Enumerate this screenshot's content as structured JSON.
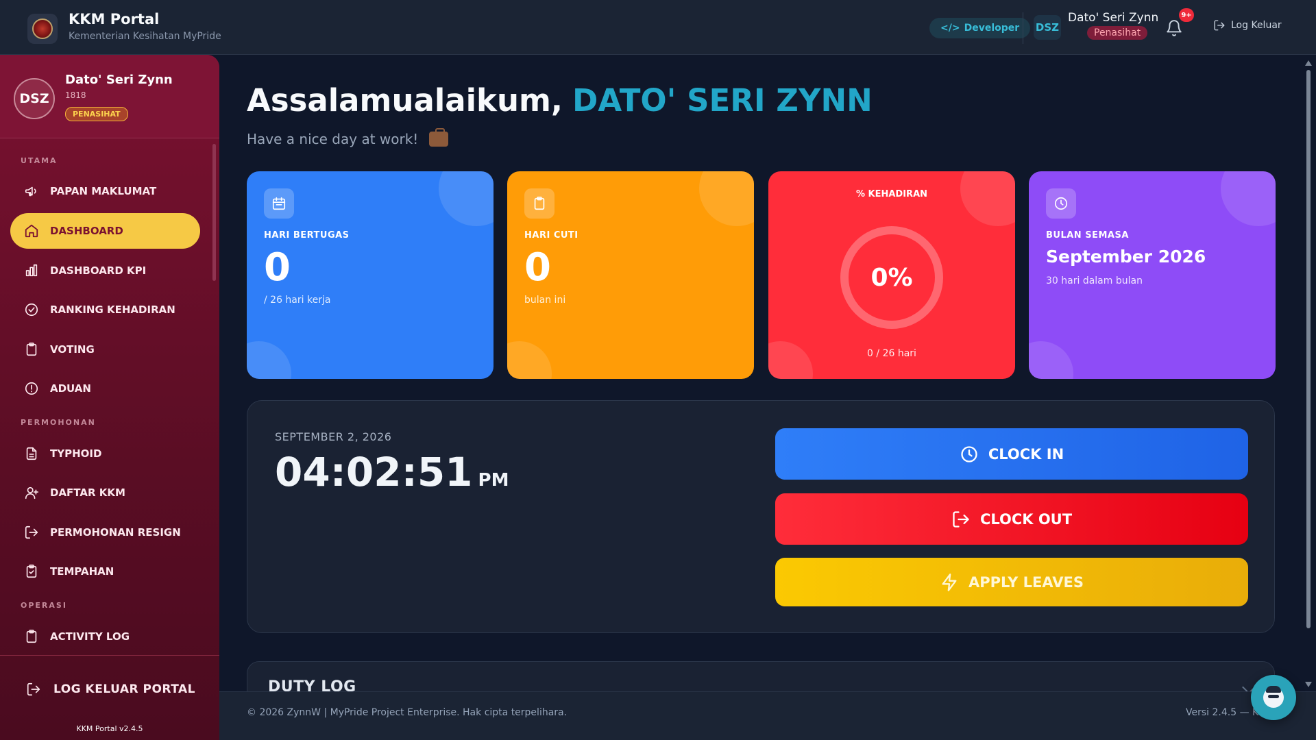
{
  "header": {
    "title": "KKM Portal",
    "subtitle": "Kementerian Kesihatan MyPride",
    "developer_label": "Developer",
    "avatar_initials": "DSZ",
    "user_name": "Dato' Seri Zynn",
    "user_role": "Penasihat",
    "notif_count": "9+",
    "logout_label": "Log Keluar"
  },
  "sidebar": {
    "profile": {
      "initials": "DSZ",
      "name": "Dato' Seri Zynn",
      "id": "1818",
      "role": "PENASIHAT"
    },
    "sections": [
      "UTAMA",
      "PERMOHONAN",
      "OPERASI"
    ],
    "items": [
      {
        "label": "PAPAN MAKLUMAT",
        "icon": "megaphone-icon"
      },
      {
        "label": "DASHBOARD",
        "icon": "home-icon",
        "active": true
      },
      {
        "label": "DASHBOARD KPI",
        "icon": "bar-chart-icon"
      },
      {
        "label": "RANKING KEHADIRAN",
        "icon": "check-circle-icon"
      },
      {
        "label": "VOTING",
        "icon": "clipboard-icon"
      },
      {
        "label": "ADUAN",
        "icon": "alert-circle-icon"
      },
      {
        "label": "TYPHOID",
        "icon": "document-icon"
      },
      {
        "label": "DAFTAR KKM",
        "icon": "user-plus-icon"
      },
      {
        "label": "PERMOHONAN RESIGN",
        "icon": "exit-icon"
      },
      {
        "label": "TEMPAHAN",
        "icon": "clipboard-check-icon"
      },
      {
        "label": "ACTIVITY LOG",
        "icon": "clipboard-icon"
      }
    ],
    "logout_label": "LOG KELUAR PORTAL",
    "version": "KKM Portal v2.4.5"
  },
  "main": {
    "greeting": "Assalamualaikum,",
    "greeting_name": "DATO' SERI ZYNN",
    "subgreeting": "Have a nice day at work!",
    "cards": {
      "duty": {
        "label": "HARI BERTUGAS",
        "value": "0",
        "note": "/ 26 hari kerja"
      },
      "leave": {
        "label": "HARI CUTI",
        "value": "0",
        "note": "bulan ini"
      },
      "attendance": {
        "label": "% KEHADIRAN",
        "value": "0%",
        "note": "0 / 26 hari"
      },
      "month": {
        "label": "BULAN SEMASA",
        "value": "September 2026",
        "note": "30 hari dalam bulan"
      }
    },
    "clock": {
      "date": "SEPTEMBER 2, 2026",
      "time": "04:02:51",
      "ampm": "PM",
      "clock_in": "CLOCK IN",
      "clock_out": "CLOCK OUT",
      "apply_leaves": "APPLY LEAVES"
    },
    "duty_log_title": "DUTY LOG"
  },
  "footer": {
    "copyright": "© 2026 ZynnW | MyPride Project Enterprise. Hak cipta terpelihara.",
    "version": "Versi 2.4.5 — KKM"
  },
  "colors": {
    "accent_cyan": "#22a6c8",
    "sidebar": "#7a1130",
    "active_nav": "#f6c945",
    "card_blue": "#2f7ef8",
    "card_orange": "#ff9c07",
    "card_red": "#ff2d3a",
    "card_purple": "#8e4cf7"
  }
}
